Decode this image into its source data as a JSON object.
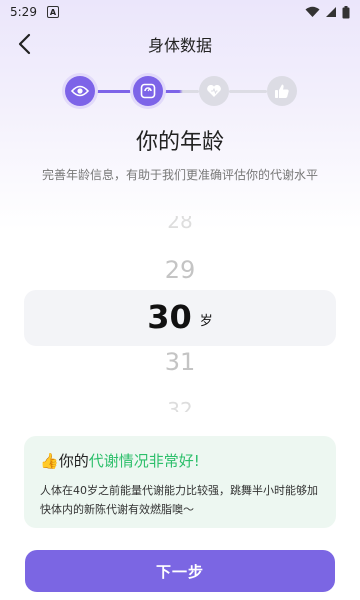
{
  "status_bar": {
    "time": "5:29",
    "notification_glyph": "A",
    "icons": [
      "wifi-icon",
      "signal-icon",
      "battery-icon"
    ]
  },
  "header": {
    "back_icon": "chevron-left-icon",
    "title": "身体数据"
  },
  "steps": {
    "current": 2,
    "total": 4,
    "items": [
      {
        "icon": "eye-icon",
        "state": "completed"
      },
      {
        "icon": "scale-icon",
        "state": "active"
      },
      {
        "icon": "heart-icon",
        "state": "inactive"
      },
      {
        "icon": "thumbs-up-icon",
        "state": "inactive"
      }
    ]
  },
  "page": {
    "title": "你的年龄",
    "subtitle": "完善年龄信息，有助于我们更准确评估你的代谢水平"
  },
  "age_picker": {
    "options": [
      "28",
      "29",
      "30",
      "31",
      "32"
    ],
    "selected": "30",
    "unit": "岁"
  },
  "info_card": {
    "emoji": "👍",
    "heading_prefix": "你的",
    "heading_highlight": "代谢情况非常好!",
    "body": "人体在40岁之前能量代谢能力比较强，跳舞半小时能够加快体内的新陈代谢有效燃脂噢～"
  },
  "next_button": {
    "label": "下一步"
  },
  "colors": {
    "accent": "#7b66e3",
    "success": "#2dbf6b",
    "card_bg": "#edf7f1",
    "inactive": "#dcdce4"
  }
}
